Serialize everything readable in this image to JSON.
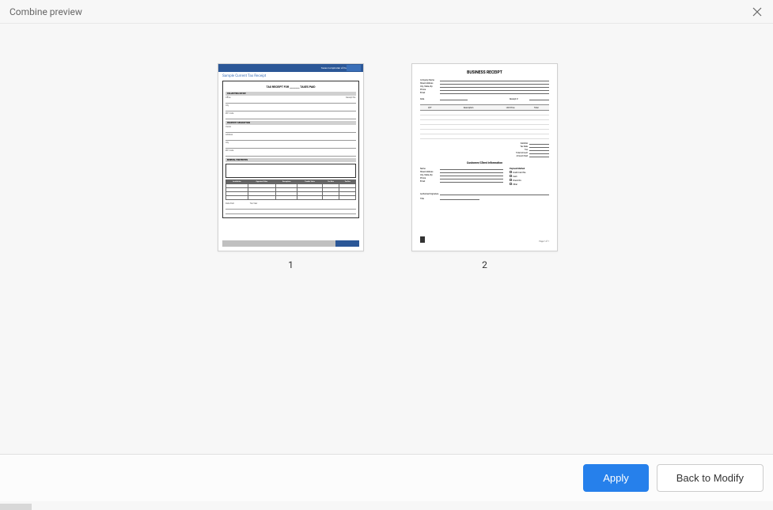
{
  "window": {
    "title": "Combine preview"
  },
  "pages": [
    {
      "number": "1",
      "doc": {
        "header_org": "Texas Comptroller of Public Accounts",
        "subtitle": "Sample Current Tax Receipt",
        "form_title": "TAX RECEIPT FOR ________ TAXES PAID",
        "section1": "COLLECTING OFFICE",
        "field_receipt": "Receipt No.",
        "field_office": "Office",
        "field_city": "City",
        "field_zip": "ZIP Code",
        "section2": "PROPERTY DESCRIPTION",
        "field_owner": "Owner",
        "field_addr": "Address",
        "field_city2": "City",
        "field_zip2": "ZIP Code",
        "section3": "MINERAL PROPERTIES",
        "table_headers": [
          "Jurisdiction",
          "Appraised Value",
          "Exemptions",
          "Taxable Value",
          "Tax Rate",
          "Tax Due"
        ],
        "bottom_field1": "Date Paid",
        "bottom_field2": "Tax Year"
      }
    },
    {
      "number": "2",
      "doc": {
        "title": "BUSINESS RECEIPT",
        "fields_top": [
          "Company Name",
          "Street Address",
          "City, State, Zip",
          "Phone",
          "Email"
        ],
        "field_date": "Date",
        "field_receipt_no": "Receipt #",
        "table_headers": [
          "QTY",
          "Description",
          "Unit Price",
          "Total"
        ],
        "totals": [
          "Subtotal",
          "Tax Rate",
          "Tax",
          "Total Amount",
          "Amount Paid"
        ],
        "customer_header": "Customer/Client Information",
        "customer_fields": [
          "Name",
          "Street Address",
          "City, State, Zip",
          "Phone",
          "Email"
        ],
        "payment_method_label": "Payment Method",
        "payment_methods": [
          "Credit Card No.",
          "Cash",
          "Check No.",
          "Other"
        ],
        "sig_label": "Authorized Signature",
        "title_label": "Title",
        "page_num": "Page 1 of 1"
      }
    }
  ],
  "footer": {
    "apply": "Apply",
    "back": "Back to Modify"
  }
}
